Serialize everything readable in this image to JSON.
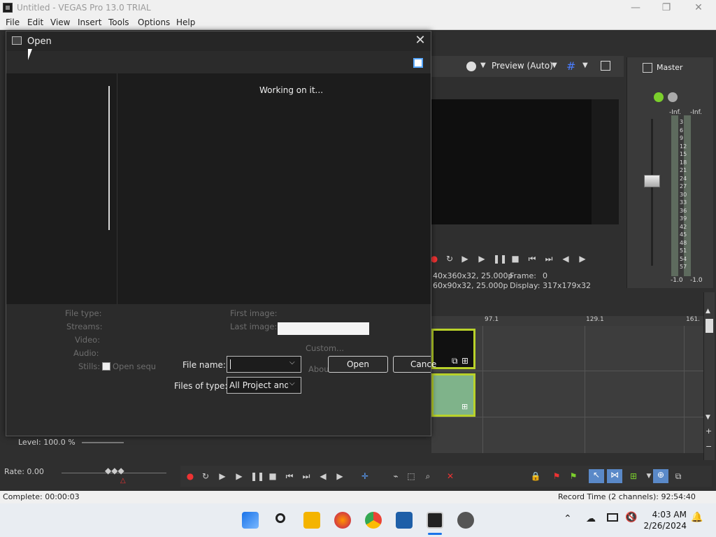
{
  "app": {
    "title": "Untitled - VEGAS Pro 13.0 TRIAL",
    "window_controls": {
      "minimize": "—",
      "maximize": "❐",
      "close": "✕"
    },
    "menu": [
      "File",
      "Edit",
      "View",
      "Insert",
      "Tools",
      "Options",
      "Help"
    ]
  },
  "preview": {
    "mode": "Preview (Auto)",
    "info": {
      "project_line": "40x360x32, 25.000p",
      "preview_line": "60x90x32, 25.000p",
      "frame_label": "Frame:",
      "frame_value": "0",
      "display_label": "Display:",
      "display_value": "317x179x32"
    }
  },
  "master": {
    "label": "Master",
    "left_inf": "-Inf.",
    "right_inf": "-Inf.",
    "scale": [
      "3",
      "6",
      "9",
      "12",
      "15",
      "18",
      "21",
      "24",
      "27",
      "30",
      "33",
      "36",
      "39",
      "42",
      "45",
      "48",
      "51",
      "54",
      "57"
    ],
    "left_bottom": "-1.0",
    "right_bottom": "-1.0"
  },
  "timeline": {
    "markers": [
      "97.1",
      "129.1",
      "161."
    ]
  },
  "level": "Level: 100.0 %",
  "rate": "Rate: 0.00",
  "status": {
    "left": "Complete: 00:00:03",
    "right": "Record Time (2 channels): 92:54:40"
  },
  "taskbar": {
    "time": "4:03 AM",
    "date": "2/26/2024"
  },
  "dialog": {
    "title": "Open",
    "close_glyph": "✕",
    "working_text": "Working on it...",
    "props": {
      "file_type": "File type:",
      "streams": "Streams:",
      "video": "Video:",
      "audio": "Audio:",
      "stills": "Stills:",
      "open_sequence": "Open sequ",
      "first_image": "First image:",
      "last_image": "Last image:",
      "custom": "Custom...",
      "about": "Abou"
    },
    "file_name_label": "File name:",
    "file_name_value": "",
    "files_of_type_label": "Files of type:",
    "files_of_type_value": "All Project and I",
    "open_button": "Open",
    "cancel_button": "Cance"
  }
}
